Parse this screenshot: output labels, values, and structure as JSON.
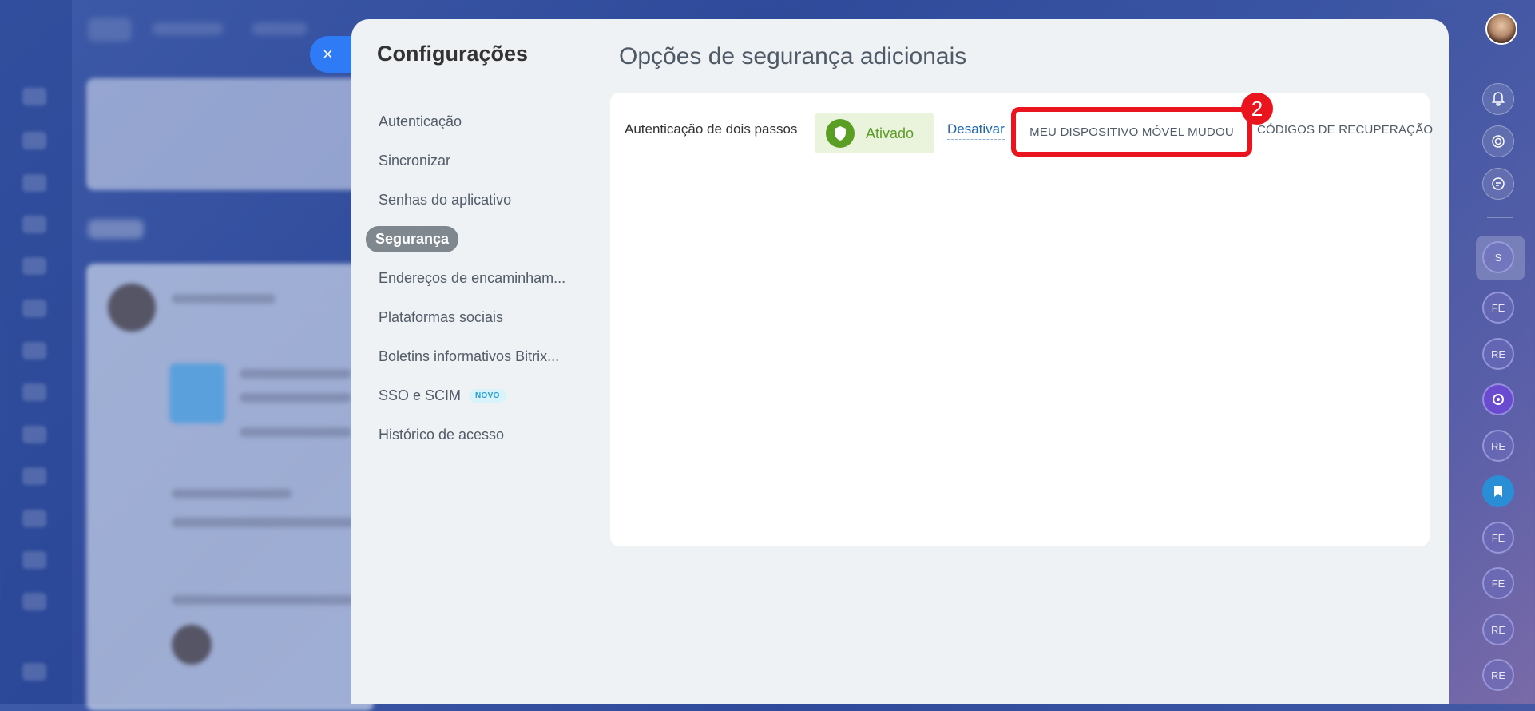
{
  "settings": {
    "title": "Configurações",
    "nav": [
      {
        "label": "Autenticação"
      },
      {
        "label": "Sincronizar"
      },
      {
        "label": "Senhas do aplicativo"
      },
      {
        "label": "Segurança"
      },
      {
        "label": "Endereços de encaminham..."
      },
      {
        "label": "Plataformas sociais"
      },
      {
        "label": "Boletins informativos Bitrix..."
      },
      {
        "label": "SSO e SCIM",
        "badge": "NOVO"
      },
      {
        "label": "Histórico de acesso"
      }
    ]
  },
  "content": {
    "title": "Opções de segurança adicionais",
    "two_step_label": "Autenticação de dois passos",
    "status": "Ativado",
    "deactivate": "Desativar",
    "device_changed": "MEU DISPOSITIVO MÓVEL MUDOU",
    "recovery_codes": "CÓDIGOS DE RECUPERAÇÃO",
    "step_number": "2"
  },
  "close_icon": "×",
  "right_rail": {
    "users": [
      "S",
      "FE",
      "RE",
      "RE",
      "FE",
      "FE",
      "RE",
      "RE"
    ]
  },
  "colors": {
    "accent": "#2f7bf6",
    "success": "#5a9e24",
    "highlight": "#e9141d",
    "link": "#2066b0"
  }
}
